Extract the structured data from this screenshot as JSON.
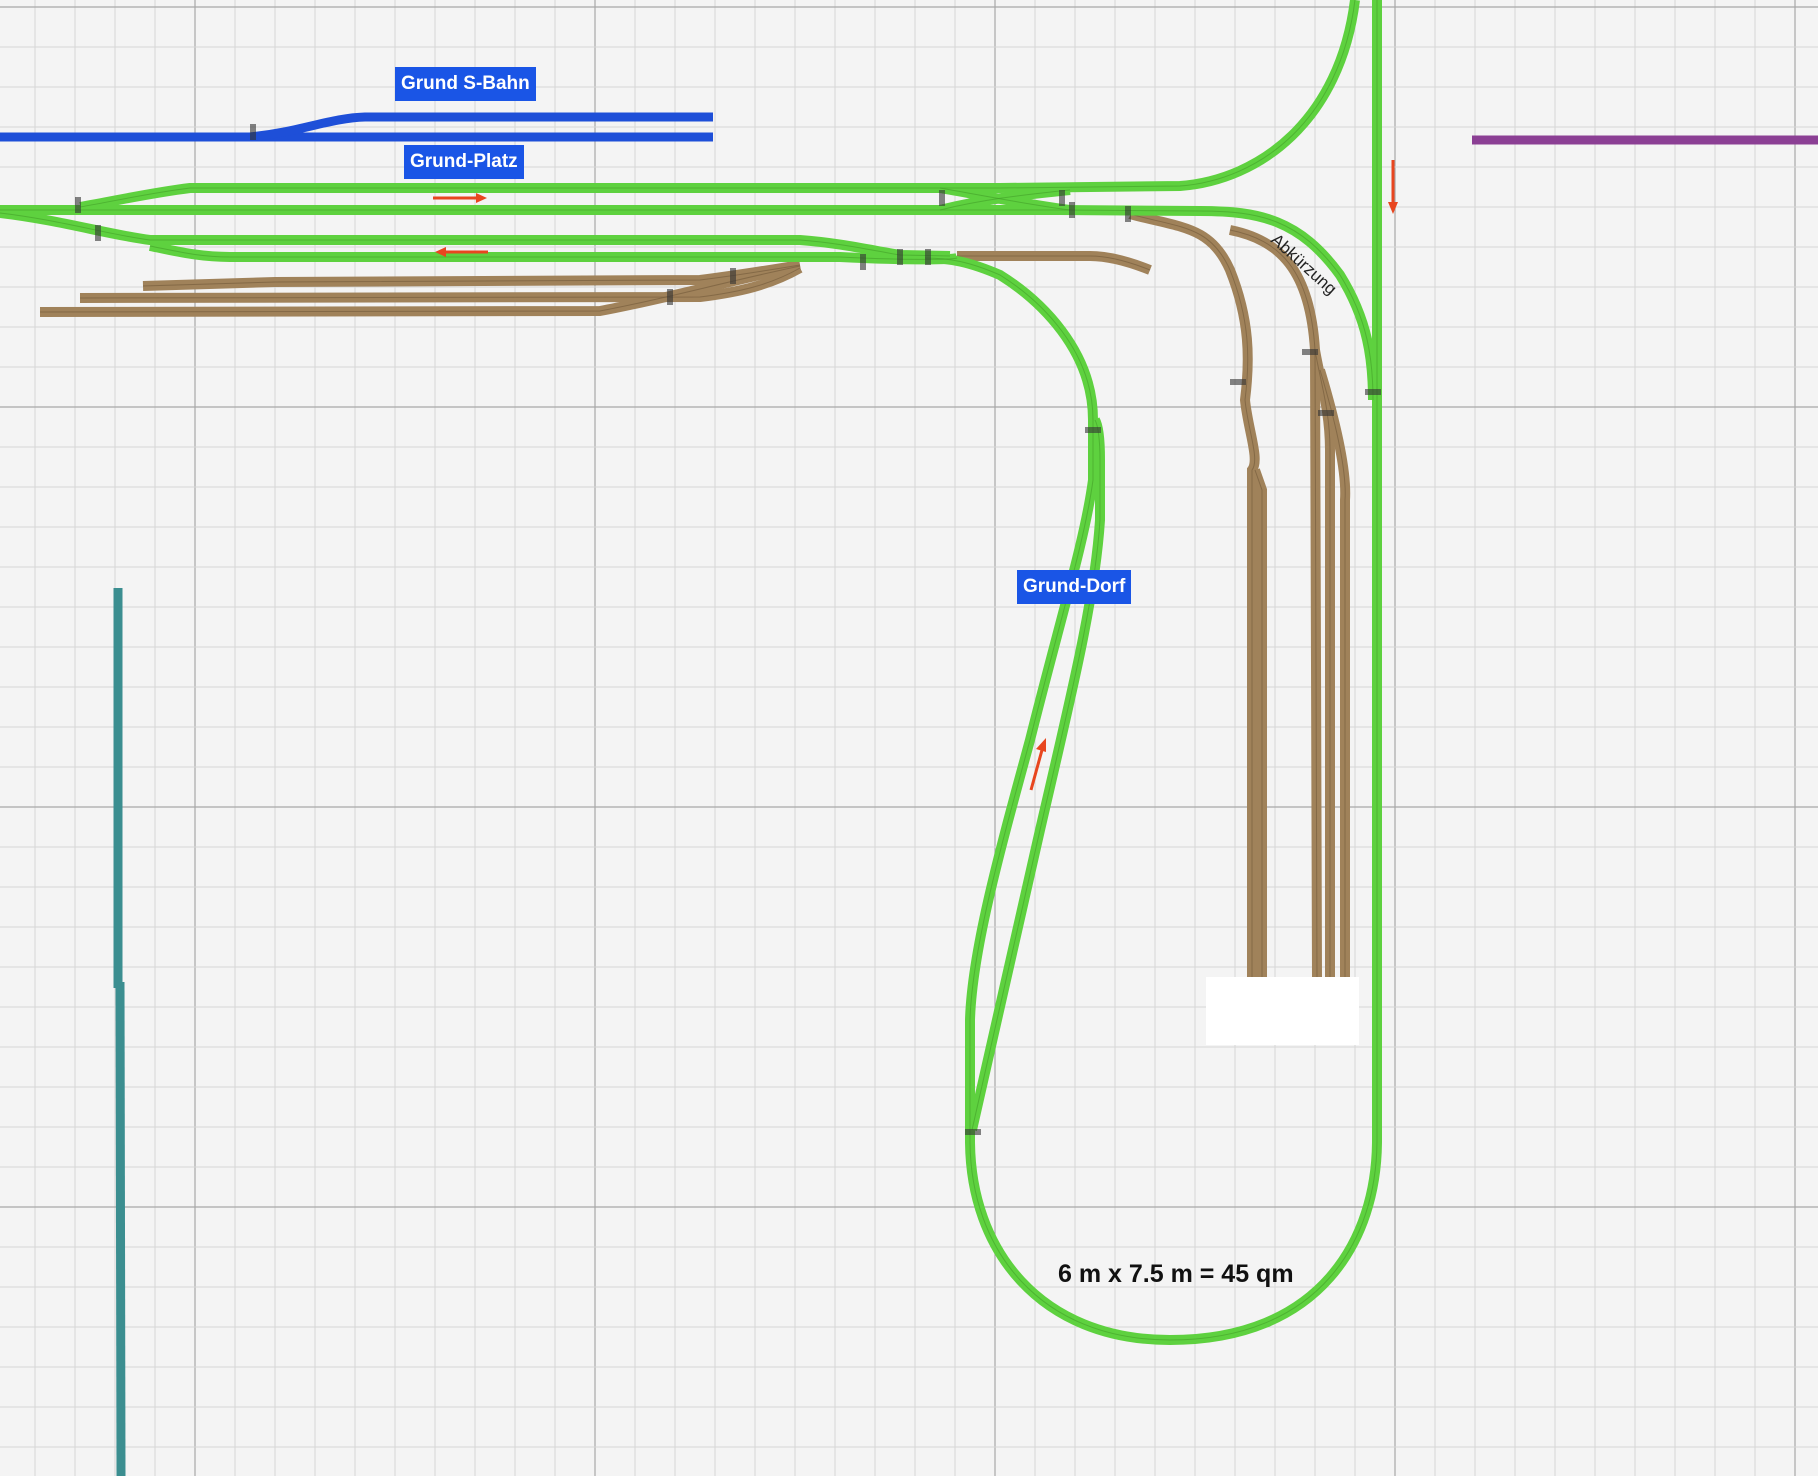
{
  "title": "",
  "labels": {
    "grund_sbahn": "Grund S-Bahn",
    "grund_platz": "Grund-Platz",
    "grund_dorf": "Grund-Dorf",
    "abkuerzung": "Abkürzung",
    "area": "6 m x 7.5 m = 45 qm"
  },
  "colors": {
    "background": "#f4f4f4",
    "grid_minor": "#d6d6d6",
    "grid_major": "#a8a8a8",
    "main_track": "#5ed13f",
    "main_track_line": "#3f9b26",
    "siding_track": "#a0825a",
    "siding_track_line": "#6e5636",
    "sbahn_track": "#1e4fd8",
    "label_bg": "#1a55e6",
    "arrow": "#e8461f",
    "purple_track": "#8b3f94",
    "teal_track": "#3b8e90"
  },
  "icons": {
    "direction_arrow": "arrow-icon"
  }
}
